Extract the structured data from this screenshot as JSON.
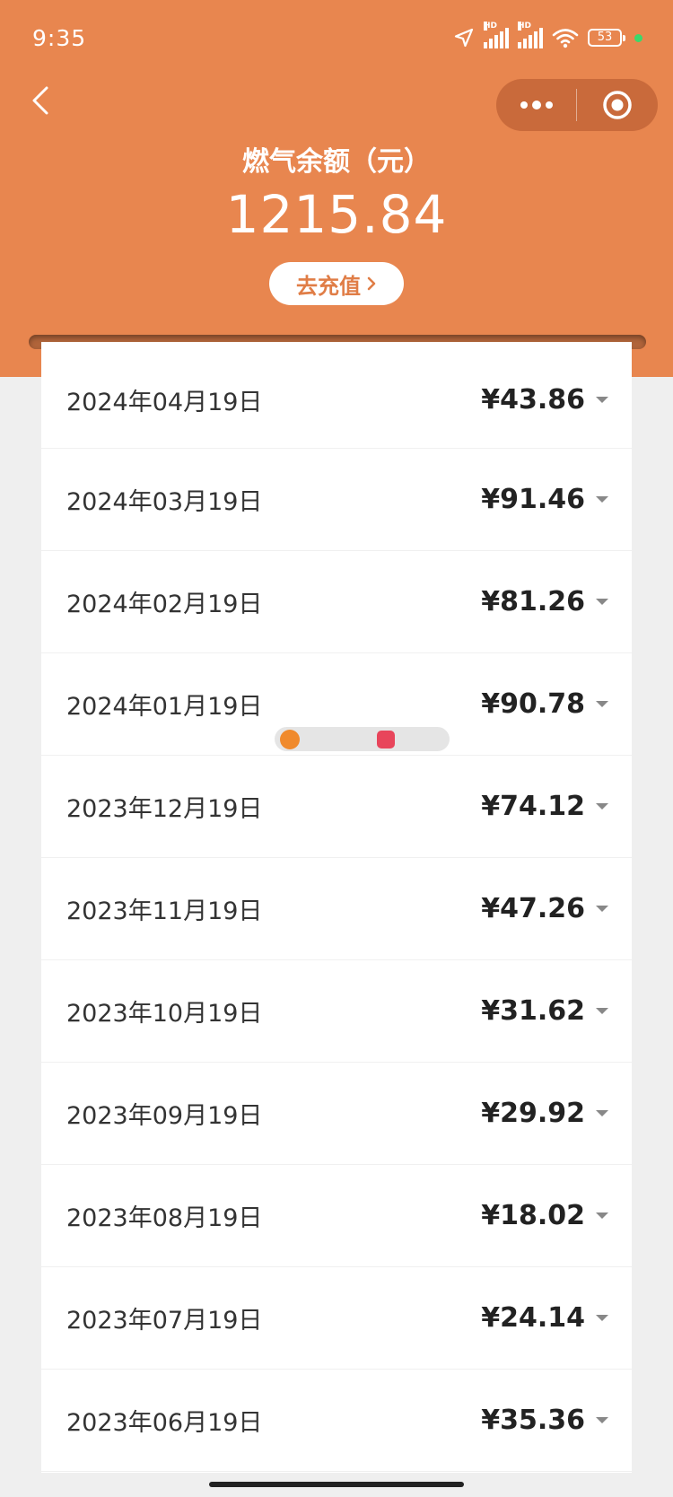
{
  "status_bar": {
    "time": "9:35",
    "battery": "53",
    "icons": [
      "location-arrow-icon",
      "hd-signal-icon",
      "hd-signal-icon",
      "wifi-icon",
      "battery-icon"
    ]
  },
  "header": {
    "balance_label": "燃气余额（元）",
    "balance_value": "1215.84",
    "recharge_label": "去充值",
    "bg_color": "#e8864f"
  },
  "records": [
    {
      "date": "2024年04月19日",
      "amount": "¥43.86"
    },
    {
      "date": "2024年03月19日",
      "amount": "¥91.46"
    },
    {
      "date": "2024年02月19日",
      "amount": "¥81.26"
    },
    {
      "date": "2024年01月19日",
      "amount": "¥90.78"
    },
    {
      "date": "2023年12月19日",
      "amount": "¥74.12"
    },
    {
      "date": "2023年11月19日",
      "amount": "¥47.26"
    },
    {
      "date": "2023年10月19日",
      "amount": "¥31.62"
    },
    {
      "date": "2023年09月19日",
      "amount": "¥29.92"
    },
    {
      "date": "2023年08月19日",
      "amount": "¥18.02"
    },
    {
      "date": "2023年07月19日",
      "amount": "¥24.14"
    },
    {
      "date": "2023年06月19日",
      "amount": "¥35.36"
    }
  ]
}
